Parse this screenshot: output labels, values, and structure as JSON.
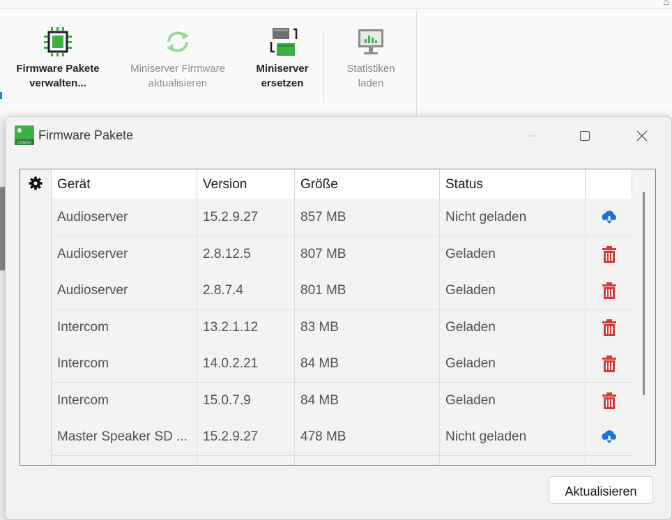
{
  "ribbon": {
    "buttons": [
      {
        "line1": "Firmware Pakete",
        "line2": "verwalten...",
        "state": "bold",
        "icon": "chip-icon"
      },
      {
        "line1": "Miniserver Firmware",
        "line2": "aktualisieren",
        "state": "disabled",
        "icon": "refresh-cycle-icon"
      },
      {
        "line1": "Miniserver",
        "line2": "ersetzen",
        "state": "bold",
        "icon": "swap-devices-icon"
      },
      {
        "line1": "Statistiken",
        "line2": "laden",
        "state": "disabled",
        "icon": "statistics-chart-icon"
      }
    ]
  },
  "dialog": {
    "title": "Firmware Pakete",
    "columns": [
      "Gerät",
      "Version",
      "Größe",
      "Status"
    ],
    "rows": [
      {
        "device": "Audioserver",
        "version": "15.2.9.27",
        "size": "857 MB",
        "status": "Nicht geladen",
        "action": "download-cloud-icon"
      },
      {
        "device": "Audioserver",
        "version": "2.8.12.5",
        "size": "807 MB",
        "status": "Geladen",
        "action": "trash-icon"
      },
      {
        "device": "Audioserver",
        "version": "2.8.7.4",
        "size": "801 MB",
        "status": "Geladen",
        "action": "trash-icon"
      },
      {
        "device": "Intercom",
        "version": "13.2.1.12",
        "size": "83 MB",
        "status": "Geladen",
        "action": "trash-icon"
      },
      {
        "device": "Intercom",
        "version": "14.0.2.21",
        "size": "84 MB",
        "status": "Geladen",
        "action": "trash-icon"
      },
      {
        "device": "Intercom",
        "version": "15.0.7.9",
        "size": "84 MB",
        "status": "Geladen",
        "action": "trash-icon"
      },
      {
        "device": "Master Speaker SD ...",
        "version": "15.2.9.27",
        "size": "478 MB",
        "status": "Nicht geladen",
        "action": "download-cloud-icon"
      }
    ],
    "refresh_label": "Aktualisieren"
  },
  "colors": {
    "accent_green": "#3cb043",
    "download_blue": "#1a73d9",
    "trash_red": "#d63a3a"
  }
}
